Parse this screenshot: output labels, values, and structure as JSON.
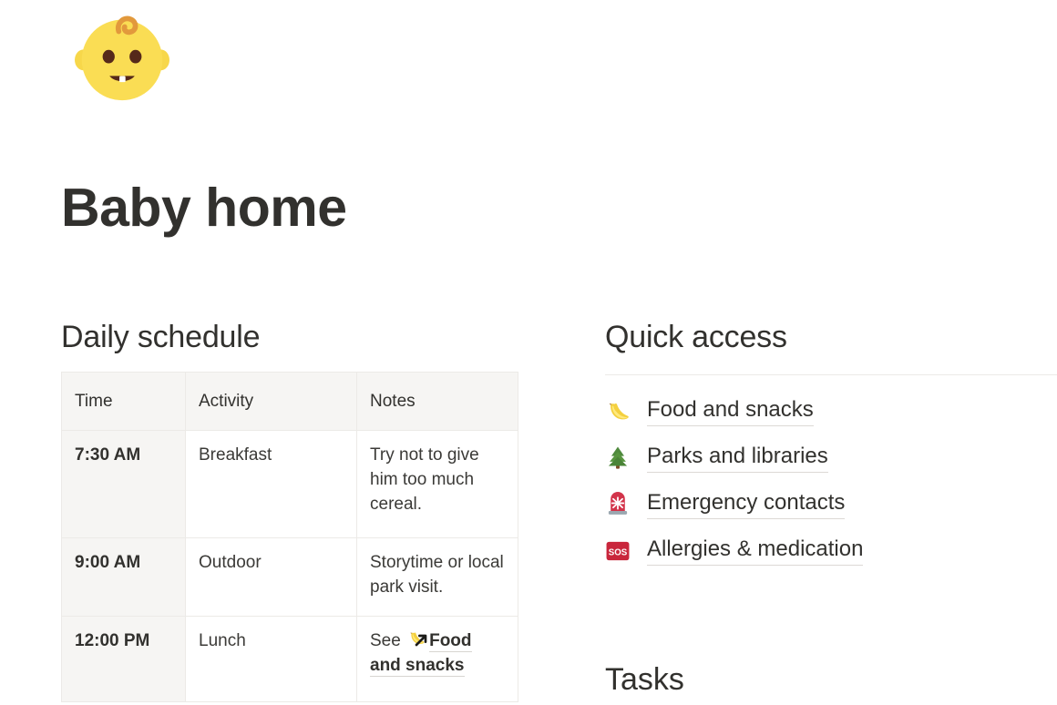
{
  "header": {
    "emoji_icon": "baby-emoji",
    "emoji_char": "👶",
    "title": "Baby home"
  },
  "colors": {
    "text": "#32312e",
    "body_text": "#3b3a37",
    "table_border": "#eceae7",
    "table_shade": "#f6f5f3",
    "link_underline": "#dcd9d5",
    "page_background": "#ffffff",
    "emoji_yellow": "#fcdb4b",
    "emoji_red": "#d22f44",
    "emoji_green": "#3f7e3f"
  },
  "daily_schedule": {
    "heading": "Daily schedule",
    "columns": [
      "Time",
      "Activity",
      "Notes"
    ],
    "rows": [
      {
        "time": "7:30 AM",
        "activity": "Breakfast",
        "notes": "Try not to give him too much cereal.",
        "notes_has_link": false
      },
      {
        "time": "9:00 AM",
        "activity": "Outdoor",
        "notes": "Storytime or local park visit.",
        "notes_has_link": false
      },
      {
        "time": "12:00 PM",
        "activity": "Lunch",
        "notes_prefix": "See ",
        "notes_link_text": "Food and snacks",
        "notes_link_icon": "banana-emoji",
        "notes_has_link": true
      }
    ]
  },
  "quick_access": {
    "heading": "Quick access",
    "items": [
      {
        "icon": "banana-emoji",
        "label": "Food and snacks"
      },
      {
        "icon": "evergreen-tree-emoji",
        "label": "Parks and libraries"
      },
      {
        "icon": "rotating-light-emoji",
        "label": "Emergency contacts"
      },
      {
        "icon": "sos-button-emoji",
        "label": "Allergies & medication"
      }
    ]
  },
  "tasks": {
    "heading": "Tasks"
  }
}
